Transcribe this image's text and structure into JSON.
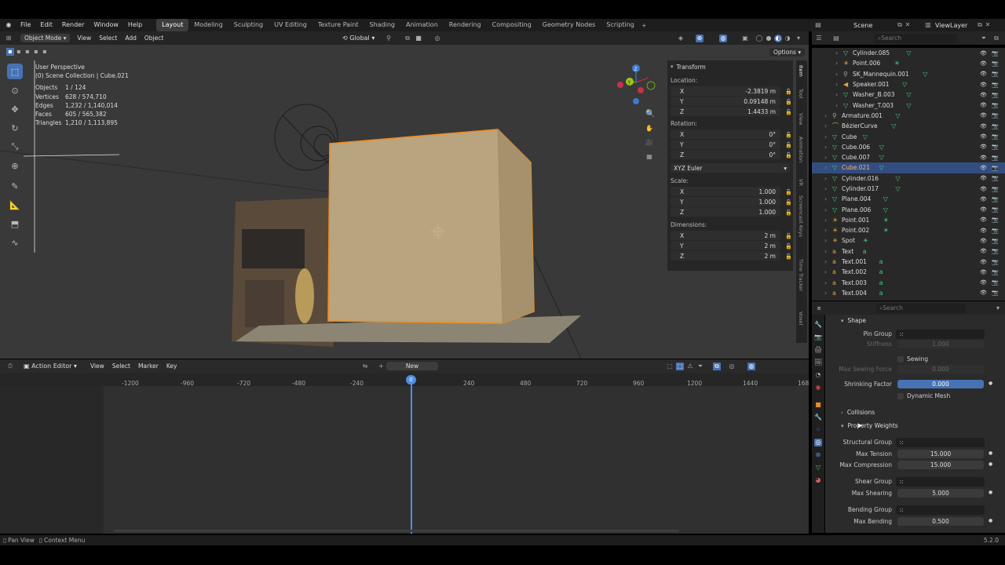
{
  "topbar": {
    "menus": [
      "File",
      "Edit",
      "Render",
      "Window",
      "Help"
    ],
    "workspaces": [
      "Layout",
      "Modeling",
      "Sculpting",
      "UV Editing",
      "Texture Paint",
      "Shading",
      "Animation",
      "Rendering",
      "Compositing",
      "Geometry Nodes",
      "Scripting"
    ],
    "active_workspace": "Layout",
    "add": "+",
    "scene": "Scene",
    "viewlayer": "ViewLayer"
  },
  "viewport": {
    "mode": "Object Mode",
    "menus": [
      "View",
      "Select",
      "Add",
      "Object"
    ],
    "transform_orientation": "Global",
    "options": "Options",
    "view_name": "User Perspective",
    "collection": "(0) Scene Collection | Cube.021",
    "stats": [
      {
        "k": "Objects",
        "v": "1 / 124"
      },
      {
        "k": "Vertices",
        "v": "628 / 574,710"
      },
      {
        "k": "Edges",
        "v": "1,232 / 1,140,014"
      },
      {
        "k": "Faces",
        "v": "605 / 565,382"
      },
      {
        "k": "Triangles",
        "v": "1,210 / 1,113,895"
      }
    ],
    "gizmo_x": "X",
    "gizmo_y": "Y",
    "gizmo_z": "Z"
  },
  "npanel": {
    "title": "Transform",
    "location_label": "Location:",
    "location": [
      {
        "a": "X",
        "v": "-2.3819 m"
      },
      {
        "a": "Y",
        "v": "0.09148 m"
      },
      {
        "a": "Z",
        "v": "1.4433 m"
      }
    ],
    "rotation_label": "Rotation:",
    "rotation": [
      {
        "a": "X",
        "v": "0°"
      },
      {
        "a": "Y",
        "v": "0°"
      },
      {
        "a": "Z",
        "v": "0°"
      }
    ],
    "rotation_mode": "XYZ Euler",
    "scale_label": "Scale:",
    "scale": [
      {
        "a": "X",
        "v": "1.000"
      },
      {
        "a": "Y",
        "v": "1.000"
      },
      {
        "a": "Z",
        "v": "1.000"
      }
    ],
    "dimensions_label": "Dimensions:",
    "dimensions": [
      {
        "a": "X",
        "v": "2 m"
      },
      {
        "a": "Y",
        "v": "2 m"
      },
      {
        "a": "Z",
        "v": "2 m"
      }
    ],
    "tabs": [
      "Item",
      "Tool",
      "View",
      "Animation",
      "VR",
      "Screencast Keys",
      "Time Tracker",
      "Voxel"
    ]
  },
  "action_editor": {
    "mode": "Action Editor",
    "menus": [
      "View",
      "Select",
      "Marker",
      "Key"
    ],
    "new": "New",
    "ticks": [
      "-1200",
      "-960",
      "-720",
      "-480",
      "-240",
      "0",
      "240",
      "480",
      "720",
      "960",
      "1200",
      "1440",
      "168"
    ],
    "current_frame": "0"
  },
  "outliner": {
    "search_placeholder": "Search",
    "items": [
      {
        "name": "Cylinder.085",
        "indent": 2,
        "icon": "mesh"
      },
      {
        "name": "Point.006",
        "indent": 2,
        "icon": "light"
      },
      {
        "name": "SK_Mannequin.001",
        "indent": 2,
        "icon": "armature"
      },
      {
        "name": "Speaker.001",
        "indent": 2,
        "icon": "speaker"
      },
      {
        "name": "Washer_B.003",
        "indent": 2,
        "icon": "mesh"
      },
      {
        "name": "Washer_T.003",
        "indent": 2,
        "icon": "mesh"
      },
      {
        "name": "Armature.001",
        "indent": 1,
        "icon": "armature"
      },
      {
        "name": "BézierCurve",
        "indent": 1,
        "icon": "curve"
      },
      {
        "name": "Cube",
        "indent": 1,
        "icon": "mesh"
      },
      {
        "name": "Cube.006",
        "indent": 1,
        "icon": "mesh"
      },
      {
        "name": "Cube.007",
        "indent": 1,
        "icon": "mesh"
      },
      {
        "name": "Cube.021",
        "indent": 1,
        "icon": "mesh",
        "selected": true
      },
      {
        "name": "Cylinder.016",
        "indent": 1,
        "icon": "mesh"
      },
      {
        "name": "Cylinder.017",
        "indent": 1,
        "icon": "mesh"
      },
      {
        "name": "Plane.004",
        "indent": 1,
        "icon": "mesh"
      },
      {
        "name": "Plane.006",
        "indent": 1,
        "icon": "mesh"
      },
      {
        "name": "Point.001",
        "indent": 1,
        "icon": "light"
      },
      {
        "name": "Point.002",
        "indent": 1,
        "icon": "light"
      },
      {
        "name": "Spot",
        "indent": 1,
        "icon": "light"
      },
      {
        "name": "Text",
        "indent": 1,
        "icon": "text"
      },
      {
        "name": "Text.001",
        "indent": 1,
        "icon": "text"
      },
      {
        "name": "Text.002",
        "indent": 1,
        "icon": "text"
      },
      {
        "name": "Text.003",
        "indent": 1,
        "icon": "text"
      },
      {
        "name": "Text.004",
        "indent": 1,
        "icon": "text"
      }
    ]
  },
  "properties": {
    "search_placeholder": "Search",
    "shape_header": "Shape",
    "pin_group": "Pin Group",
    "stiffness": "Stiffness",
    "stiffness_val": "1.000",
    "sewing": "Sewing",
    "max_sewing_force": "Max Sewing Force",
    "max_sewing_force_val": "0.000",
    "shrinking_factor": "Shrinking Factor",
    "shrinking_factor_val": "0.000",
    "dynamic_mesh": "Dynamic Mesh",
    "collisions_header": "Collisions",
    "property_weights_header": "Property Weights",
    "structural_group": "Structural Group",
    "max_tension": "Max Tension",
    "max_tension_val": "15.000",
    "max_compression": "Max Compression",
    "max_compression_val": "15.000",
    "shear_group": "Shear Group",
    "max_shearing": "Max Shearing",
    "max_shearing_val": "5.000",
    "bending_group": "Bending Group",
    "max_bending": "Max Bending",
    "max_bending_val": "0.500"
  },
  "statusbar": {
    "pan_view": "Pan View",
    "context_menu": "Context Menu",
    "version": "5.2.0"
  },
  "colors": {
    "accent": "#4772b3",
    "selected_outline": "#f28c1f",
    "cube": "#b8a47e"
  }
}
